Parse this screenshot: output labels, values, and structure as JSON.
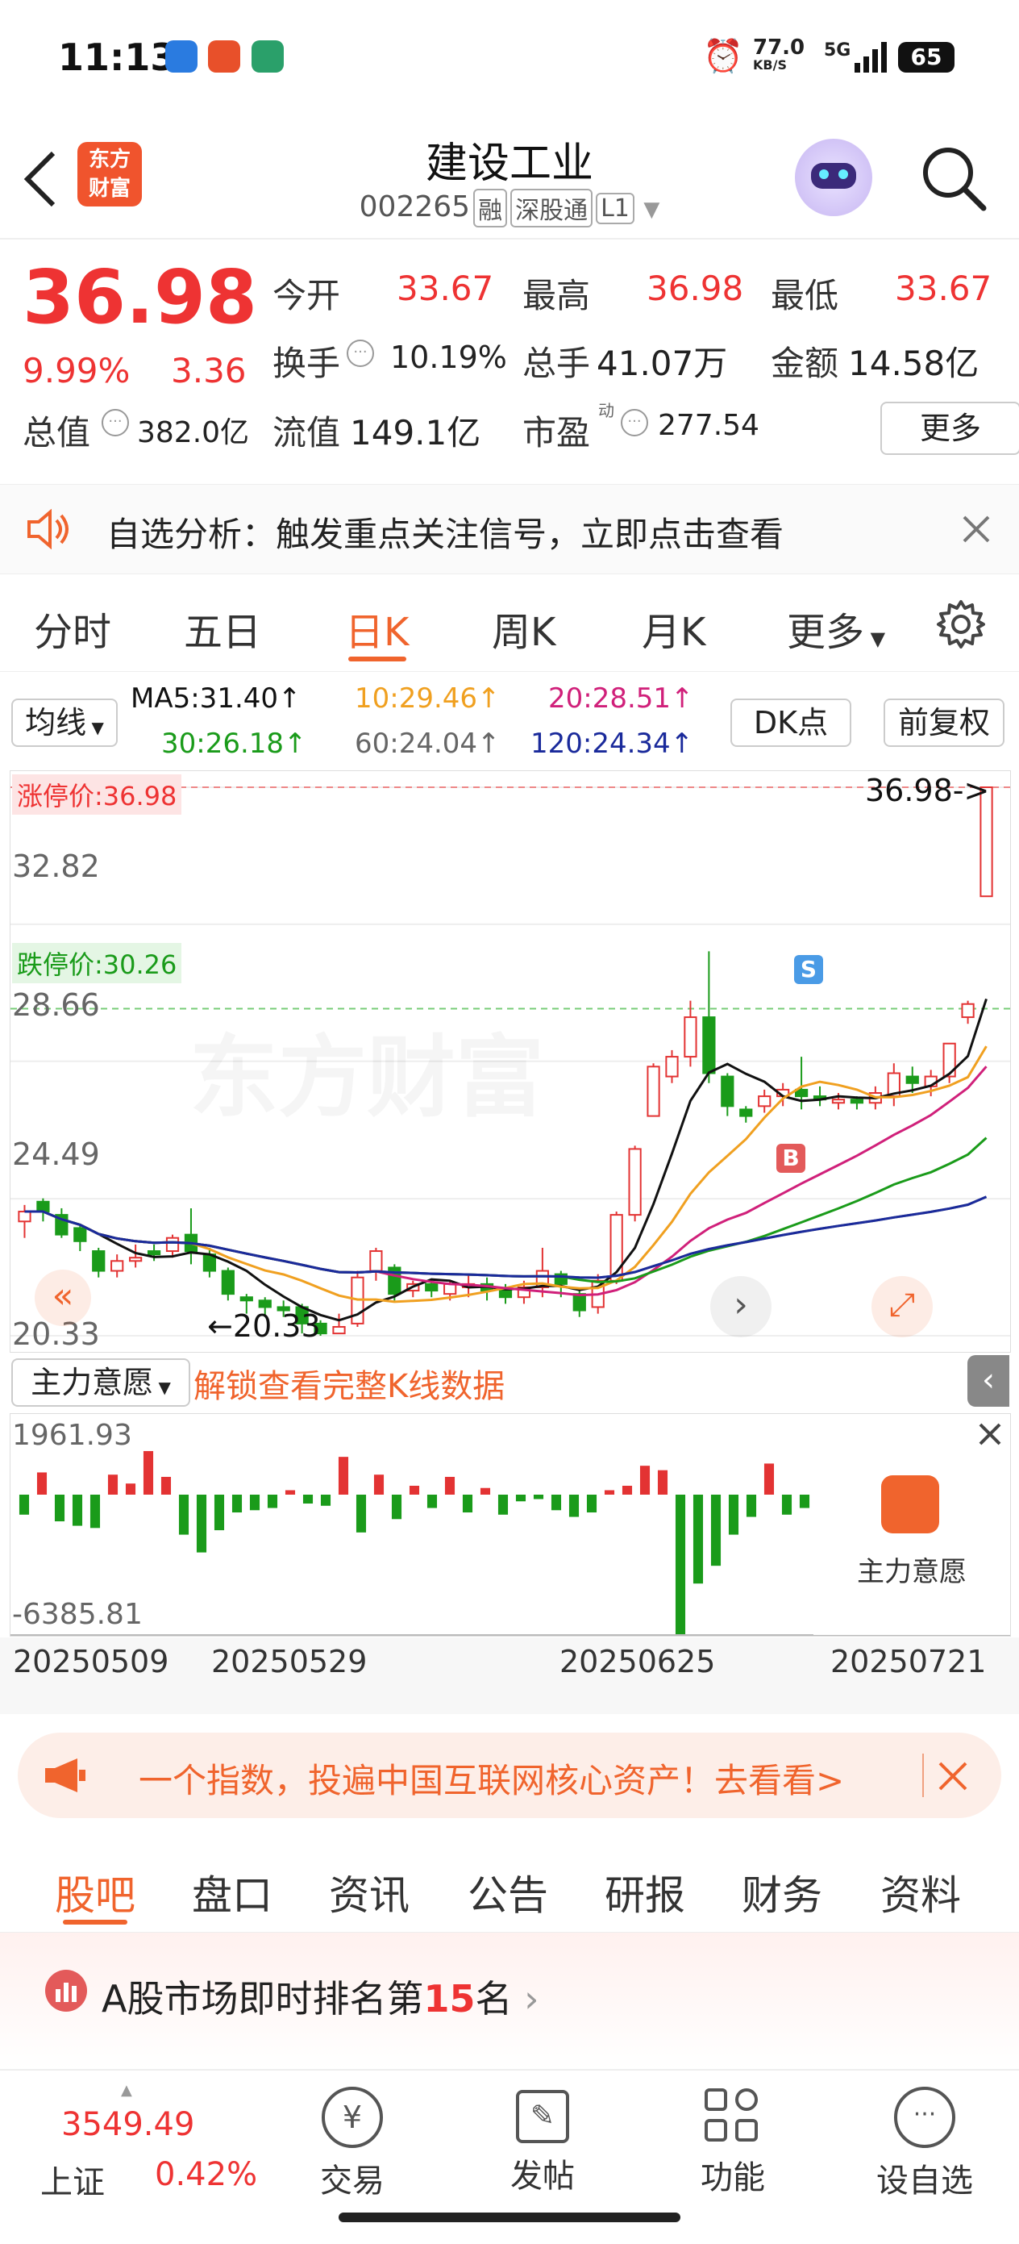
{
  "status_bar": {
    "time": "11:13",
    "speed": "77.0",
    "speed_unit": "KB/S",
    "net": "5G",
    "battery": "65"
  },
  "header": {
    "title": "建设工业",
    "code": "002265",
    "tags": [
      "融",
      "深股通",
      "L1"
    ],
    "logo_text": "东方\n财富"
  },
  "quote": {
    "price": "36.98",
    "change_pct": "9.99%",
    "change": "3.36",
    "open_label": "今开",
    "open": "33.67",
    "high_label": "最高",
    "high": "36.98",
    "low_label": "最低",
    "low": "33.67",
    "turnover_label": "换手",
    "turnover": "10.19%",
    "volume_label": "总手",
    "volume": "41.07万",
    "amount_label": "金额",
    "amount": "14.58亿",
    "mcap_label": "总值",
    "mcap": "382.0亿",
    "float_label": "流值",
    "float": "149.1亿",
    "pe_label": "市盈",
    "pe_sup": "动",
    "pe": "277.54",
    "more": "更多"
  },
  "notice": {
    "text": "自选分析：触发重点关注信号，立即点击查看"
  },
  "ktabs": [
    "分时",
    "五日",
    "日K",
    "周K",
    "月K",
    "更多"
  ],
  "active_ktab": 2,
  "ma": {
    "selector": "均线",
    "ma5": "MA5:31.40↑",
    "ma10": "10:29.46↑",
    "ma20": "20:28.51↑",
    "ma30": "30:26.18↑",
    "ma60": "60:24.04↑",
    "ma120": "120:24.34↑",
    "dk": "DK点",
    "fq": "前复权"
  },
  "chart_labels": {
    "limit_up": "涨停价:36.98",
    "limit_down": "跌停价:30.26",
    "last": "36.98->",
    "y_ticks": [
      "32.82",
      "28.66",
      "24.49",
      "20.33"
    ],
    "low_mark": "20.33",
    "buy": "B",
    "sell": "S",
    "watermark": "东方财富"
  },
  "colors": {
    "up": "#e33333",
    "down": "#1a9b1a",
    "ma5": "#111111",
    "ma10": "#f0a020",
    "ma20": "#d0207a",
    "ma30": "#1a9b1a",
    "ma60": "#888888",
    "ma120": "#1a2a9b"
  },
  "sub": {
    "selector": "主力意愿",
    "unlock": "解锁查看完整K线数据",
    "top": "1961.93",
    "bottom": "-6385.81",
    "panel_label": "主力意愿"
  },
  "dates": [
    "20250509",
    "20250529",
    "20250625",
    "20250721"
  ],
  "banner": {
    "text": "一个指数，投遍中国互联网核心资产！去看看>"
  },
  "news_tabs": [
    "股吧",
    "盘口",
    "资讯",
    "公告",
    "研报",
    "财务",
    "资料"
  ],
  "active_news_tab": 0,
  "rank": {
    "prefix": "A股市场即时排名第",
    "rank": "15",
    "suffix": "名"
  },
  "bottom": {
    "index_value": "3549.49",
    "index_name": "上证",
    "index_change": "0.42%",
    "items": [
      "交易",
      "发帖",
      "功能",
      "设自选"
    ]
  },
  "chart_data": {
    "type": "candlestick",
    "y_range": [
      20.33,
      36.98
    ],
    "candles": [
      [
        23.8,
        24.1,
        23.3,
        24.3
      ],
      [
        24.4,
        24.1,
        23.8,
        24.5
      ],
      [
        24.0,
        23.4,
        23.3,
        24.2
      ],
      [
        23.6,
        23.2,
        22.9,
        23.7
      ],
      [
        22.9,
        22.3,
        22.1,
        23.0
      ],
      [
        22.3,
        22.6,
        22.1,
        22.8
      ],
      [
        22.6,
        22.7,
        22.4,
        23.1
      ],
      [
        22.9,
        22.8,
        22.6,
        23.1
      ],
      [
        22.9,
        23.3,
        22.7,
        23.4
      ],
      [
        23.4,
        22.9,
        22.5,
        24.2
      ],
      [
        22.8,
        22.3,
        22.1,
        23.0
      ],
      [
        22.3,
        21.6,
        21.4,
        22.4
      ],
      [
        21.5,
        21.4,
        21.0,
        21.6
      ],
      [
        21.4,
        21.2,
        20.9,
        21.5
      ],
      [
        21.2,
        21.1,
        20.9,
        21.4
      ],
      [
        21.2,
        20.7,
        20.4,
        21.3
      ],
      [
        20.7,
        20.4,
        20.33,
        20.8
      ],
      [
        20.4,
        20.6,
        20.4,
        21.0
      ],
      [
        20.7,
        22.1,
        20.6,
        22.3
      ],
      [
        22.3,
        22.9,
        22.0,
        23.0
      ],
      [
        22.4,
        21.6,
        21.4,
        22.5
      ],
      [
        21.7,
        21.9,
        21.5,
        22.0
      ],
      [
        21.9,
        21.7,
        21.5,
        22.0
      ],
      [
        21.6,
        21.9,
        21.4,
        22.0
      ],
      [
        21.8,
        21.9,
        21.5,
        22.2
      ],
      [
        21.9,
        21.7,
        21.4,
        22.1
      ],
      [
        21.7,
        21.5,
        21.3,
        21.9
      ],
      [
        21.5,
        21.8,
        21.3,
        22.0
      ],
      [
        21.8,
        22.3,
        21.5,
        23.0
      ],
      [
        22.2,
        21.9,
        21.5,
        22.3
      ],
      [
        21.6,
        21.1,
        20.9,
        21.7
      ],
      [
        21.2,
        22.0,
        21.0,
        22.2
      ],
      [
        22.0,
        24.0,
        21.9,
        24.1
      ],
      [
        24.0,
        26.0,
        23.8,
        26.1
      ],
      [
        27.0,
        28.5,
        27.0,
        28.6
      ],
      [
        28.2,
        28.8,
        28.0,
        29.0
      ],
      [
        28.8,
        30.0,
        28.5,
        30.5
      ],
      [
        30.0,
        28.3,
        28.0,
        32.0
      ],
      [
        28.2,
        27.3,
        27.0,
        28.3
      ],
      [
        27.2,
        27.0,
        26.8,
        27.3
      ],
      [
        27.3,
        27.6,
        27.1,
        27.8
      ],
      [
        27.6,
        27.8,
        27.3,
        28.0
      ],
      [
        27.8,
        27.6,
        27.2,
        28.8
      ],
      [
        27.6,
        27.5,
        27.3,
        27.9
      ],
      [
        27.4,
        27.5,
        27.2,
        27.7
      ],
      [
        27.5,
        27.4,
        27.2,
        27.6
      ],
      [
        27.4,
        27.7,
        27.2,
        27.9
      ],
      [
        27.6,
        28.3,
        27.3,
        28.6
      ],
      [
        28.2,
        28.0,
        27.7,
        28.5
      ],
      [
        27.9,
        28.2,
        27.6,
        28.4
      ],
      [
        28.2,
        29.2,
        28.0,
        29.2
      ],
      [
        30.0,
        30.4,
        29.8,
        30.5
      ],
      [
        33.67,
        36.98,
        33.67,
        36.98
      ]
    ]
  }
}
